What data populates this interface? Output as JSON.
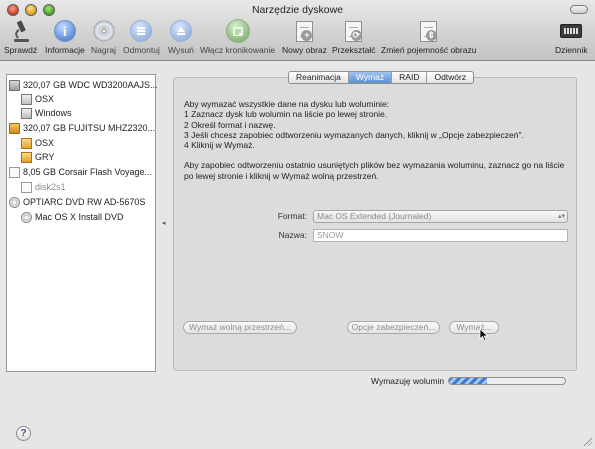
{
  "window": {
    "title": "Narzędzie dyskowe"
  },
  "toolbar": {
    "items": [
      {
        "label": "Sprawdź",
        "icon": "microscope-icon"
      },
      {
        "label": "Informacje",
        "icon": "info-icon"
      },
      {
        "label": "Nagraj",
        "icon": "burn-icon"
      },
      {
        "label": "Odmontuj",
        "icon": "unmount-icon"
      },
      {
        "label": "Wysuń",
        "icon": "eject-icon"
      },
      {
        "label": "Włącz kronikowanie",
        "icon": "journaling-icon"
      },
      {
        "label": "Nowy obraz",
        "icon": "new-image-icon"
      },
      {
        "label": "Przekształć",
        "icon": "convert-icon"
      },
      {
        "label": "Zmień pojemność obrazu",
        "icon": "resize-image-icon"
      }
    ],
    "log_label": "Dziennik"
  },
  "sidebar": {
    "items": [
      {
        "label": "320,07 GB WDC WD3200AAJS...",
        "icon": "hard-disk-icon"
      },
      {
        "label": "OSX",
        "icon": "volume-icon"
      },
      {
        "label": "Windows",
        "icon": "volume-icon"
      },
      {
        "label": "320,07 GB FUJITSU MHZ2320...",
        "icon": "external-disk-icon"
      },
      {
        "label": "OSX",
        "icon": "volume-icon"
      },
      {
        "label": "GRY",
        "icon": "volume-icon"
      },
      {
        "label": "8,05 GB Corsair Flash Voyage...",
        "icon": "usb-drive-icon"
      },
      {
        "label": "disk2s1",
        "icon": "volume-icon"
      },
      {
        "label": "OPTIARC DVD RW AD-5670S",
        "icon": "optical-drive-icon"
      },
      {
        "label": "Mac OS X Install DVD",
        "icon": "disc-icon"
      }
    ]
  },
  "tabs": [
    "Reanimacja",
    "Wymaż",
    "RAID",
    "Odtwórz"
  ],
  "instructions": {
    "lines": [
      "Aby wymazać wszystkie dane na dysku lub woluminie:",
      "1 Zaznacz dysk lub wolumin na liście po lewej stronie.",
      "2 Określ format i nazwę.",
      "3 Jeśli chcesz zapobiec odtworzeniu wymazanych danych, kliknij w „Opcje zabezpieczeń\".",
      "4 Kliknij w Wymaż."
    ],
    "note_lines": [
      "Aby zapobiec odtworzeniu ostatnio usuniętych plików bez wymazania woluminu, zaznacz go na liście",
      "po lewej stronie i kliknij w Wymaż wolną przestrzeń."
    ]
  },
  "form": {
    "format_label": "Format:",
    "format_value": "Mac OS Extended (Journaled)",
    "name_label": "Nazwa:",
    "name_value": "SNOW"
  },
  "buttons": {
    "erase_free_space": "Wymaż wolną przestrzeń...",
    "security_options": "Opcje zabezpieczeń...",
    "erase": "Wymaż..."
  },
  "status": {
    "progress_label": "Wymazuję wolumin",
    "progress_fraction": 0.33
  },
  "help_label": "?"
}
